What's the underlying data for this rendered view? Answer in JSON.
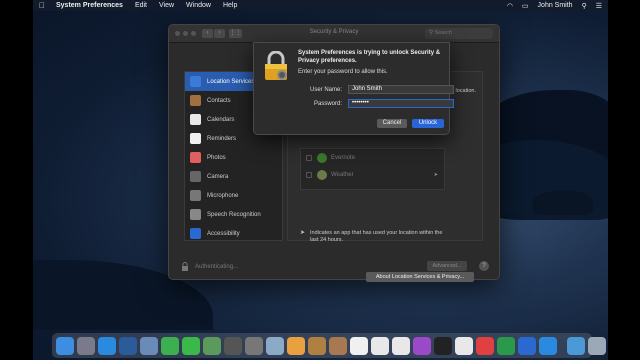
{
  "menubar": {
    "app_name": "System Preferences",
    "items": [
      "Edit",
      "View",
      "Window",
      "Help"
    ],
    "user": "John Smith"
  },
  "window": {
    "title": "Security & Privacy",
    "search_placeholder": "Search",
    "location_note": "location.",
    "sidebar": [
      {
        "label": "Location Services",
        "icon": "location-icon",
        "color": "#3a7bd5",
        "selected": true
      },
      {
        "label": "Contacts",
        "icon": "contacts-icon",
        "color": "#a07040",
        "selected": false
      },
      {
        "label": "Calendars",
        "icon": "calendar-icon",
        "color": "#e8e8e8",
        "selected": false
      },
      {
        "label": "Reminders",
        "icon": "reminders-icon",
        "color": "#f0f0f0",
        "selected": false
      },
      {
        "label": "Photos",
        "icon": "photos-icon",
        "color": "#e06060",
        "selected": false
      },
      {
        "label": "Camera",
        "icon": "camera-icon",
        "color": "#666666",
        "selected": false
      },
      {
        "label": "Microphone",
        "icon": "microphone-icon",
        "color": "#777777",
        "selected": false
      },
      {
        "label": "Speech Recognition",
        "icon": "speech-icon",
        "color": "#888888",
        "selected": false
      },
      {
        "label": "Accessibility",
        "icon": "accessibility-icon",
        "color": "#2a6ad0",
        "selected": false
      }
    ],
    "apps": [
      {
        "name": "Evernote",
        "has_arrow": false
      },
      {
        "name": "Weather",
        "has_arrow": true
      }
    ],
    "indicator_text": "Indicates an app that has used your location within the last 24 hours.",
    "about_button": "About Location Services & Privacy...",
    "lock_status": "Authenticating...",
    "advanced_button": "Advanced...",
    "help_button": "?"
  },
  "dialog": {
    "title": "System Preferences is trying to unlock Security & Privacy preferences.",
    "message": "Enter your password to allow this.",
    "username_label": "User Name:",
    "username_value": "John Smith",
    "password_label": "Password:",
    "password_value": "••••••••",
    "cancel_label": "Cancel",
    "unlock_label": "Unlock"
  },
  "dock": {
    "icons": [
      {
        "name": "finder-icon",
        "color": "#3d8ee0"
      },
      {
        "name": "launchpad-icon",
        "color": "#7a7a8a"
      },
      {
        "name": "safari-icon",
        "color": "#2a8ae0"
      },
      {
        "name": "chrome-icon",
        "color": "#2c5b9a"
      },
      {
        "name": "mail-icon",
        "color": "#6a8ab8"
      },
      {
        "name": "facetime-icon",
        "color": "#3cb050"
      },
      {
        "name": "messages-icon",
        "color": "#3ab84a"
      },
      {
        "name": "maps-icon",
        "color": "#5a9a5a"
      },
      {
        "name": "mission-control-icon",
        "color": "#555555"
      },
      {
        "name": "settings-icon",
        "color": "#777777"
      },
      {
        "name": "preview-icon",
        "color": "#8aaac8"
      },
      {
        "name": "photos-icon",
        "color": "#e8a040"
      },
      {
        "name": "notes-icon",
        "color": "#b08040"
      },
      {
        "name": "contacts-icon",
        "color": "#a87850"
      },
      {
        "name": "calendar-icon",
        "color": "#f0f0f0"
      },
      {
        "name": "reminders-icon",
        "color": "#e8e8e8"
      },
      {
        "name": "music-icon",
        "color": "#e8e8e8"
      },
      {
        "name": "podcasts-icon",
        "color": "#9a4ac8"
      },
      {
        "name": "tv-icon",
        "color": "#222222"
      },
      {
        "name": "news-icon",
        "color": "#e8e8e8"
      },
      {
        "name": "news2-icon",
        "color": "#e04040"
      },
      {
        "name": "numbers-icon",
        "color": "#2a9a4a"
      },
      {
        "name": "keynote-icon",
        "color": "#2a6ad0"
      },
      {
        "name": "app-store-icon",
        "color": "#2a8ae0"
      }
    ],
    "right_icons": [
      {
        "name": "downloads-folder-icon",
        "color": "#4a9ad8"
      },
      {
        "name": "trash-icon",
        "color": "#9aa8b8"
      }
    ]
  }
}
